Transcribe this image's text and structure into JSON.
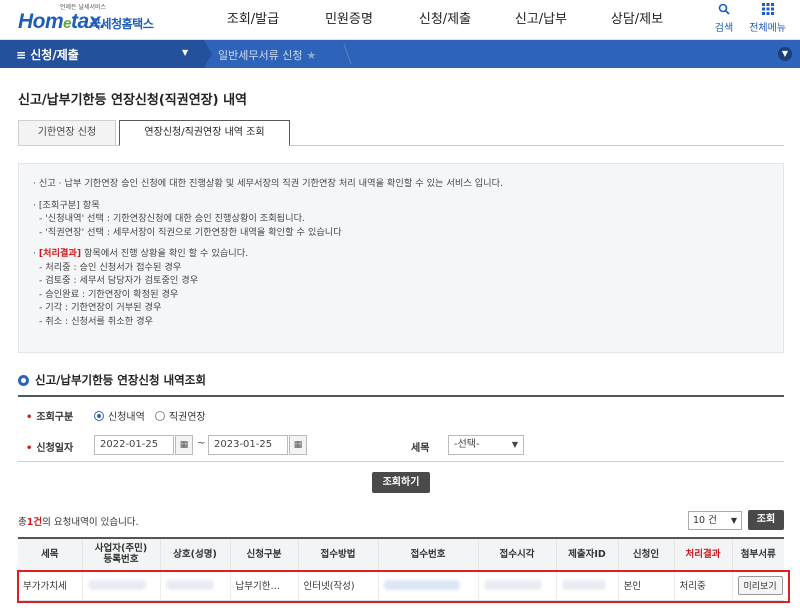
{
  "header": {
    "logo_small": "언제든 날세서비스",
    "logo_main": "Hometax",
    "logo_kor": "국세청홈택스",
    "nav": [
      "조회/발급",
      "민원증명",
      "신청/제출",
      "신고/납부",
      "상담/제보"
    ],
    "util": [
      {
        "label": "검색",
        "icon": "search-icon"
      },
      {
        "label": "전체메뉴",
        "icon": "grid-menu-icon"
      }
    ]
  },
  "bar": {
    "menu_label": "≡  신청/제출",
    "breadcrumb": "일반세무서류 신청"
  },
  "page_title": "신고/납부기한등 연장신청(직권연장) 내역",
  "tabs": [
    "기한연장 신청",
    "연장신청/직권연장 내역 조회"
  ],
  "info": {
    "line1": "· 신고 · 납부 기한연장 승인 신청에 대한 진행상황 및 세무서장의 직권 기한연장 처리 내역을 확인할 수 있는 서비스 입니다.",
    "line2": "· [조회구분] 항목",
    "line3": "- '신청내역' 선택 : 기한연장신청에 대한 승인 진행상황이 조회됩니다.",
    "line4": "- '직권연장' 선택 : 세무서장이 직권으로 기한연장한 내역을 확인할 수 있습니다",
    "line5_red": "[처리결과]",
    "line5_rest": " 항목에서 진행 상황을 확인 할 수 있습니다.",
    "line6": "- 처리중 : 승인 신청서가 접수된 경우",
    "line7": "- 검토중 : 세무서 담당자가 검토중인 경우",
    "line8": "- 승인완료 : 기한연장이 확정된 경우",
    "line9": "- 기각 : 기한연장이 거부된 경우",
    "line10": "- 취소 : 신청서를 취소한 경우"
  },
  "section_title": "신고/납부기한등 연장신청 내역조회",
  "search": {
    "type_label": "조회구분",
    "options": [
      "신청내역",
      "직권연장"
    ],
    "selected": "신청내역",
    "date_label": "신청일자",
    "date_from": "2022-01-25",
    "tilde": "~",
    "date_to": "2023-01-25",
    "tax_label": "세목",
    "tax_value": "-선택-",
    "submit": "조회하기"
  },
  "results": {
    "count_prefix": "총",
    "count": "1건",
    "count_suffix": "의 요청내역이 있습니다.",
    "page_size": "10 건",
    "search_btn": "조회"
  },
  "table": {
    "headers": [
      "세목",
      "사업자(주민)\n등록번호",
      "상호(성명)",
      "신청구분",
      "접수방법",
      "접수번호",
      "접수시각",
      "제출자ID",
      "신청인",
      "처리결과",
      "첨부서류"
    ],
    "row": {
      "tax": "부가가치세",
      "apply_type": "납부기한…",
      "method": "인터넷(작성)",
      "applicant": "본인",
      "result": "처리중",
      "attach": "미리보기"
    }
  }
}
